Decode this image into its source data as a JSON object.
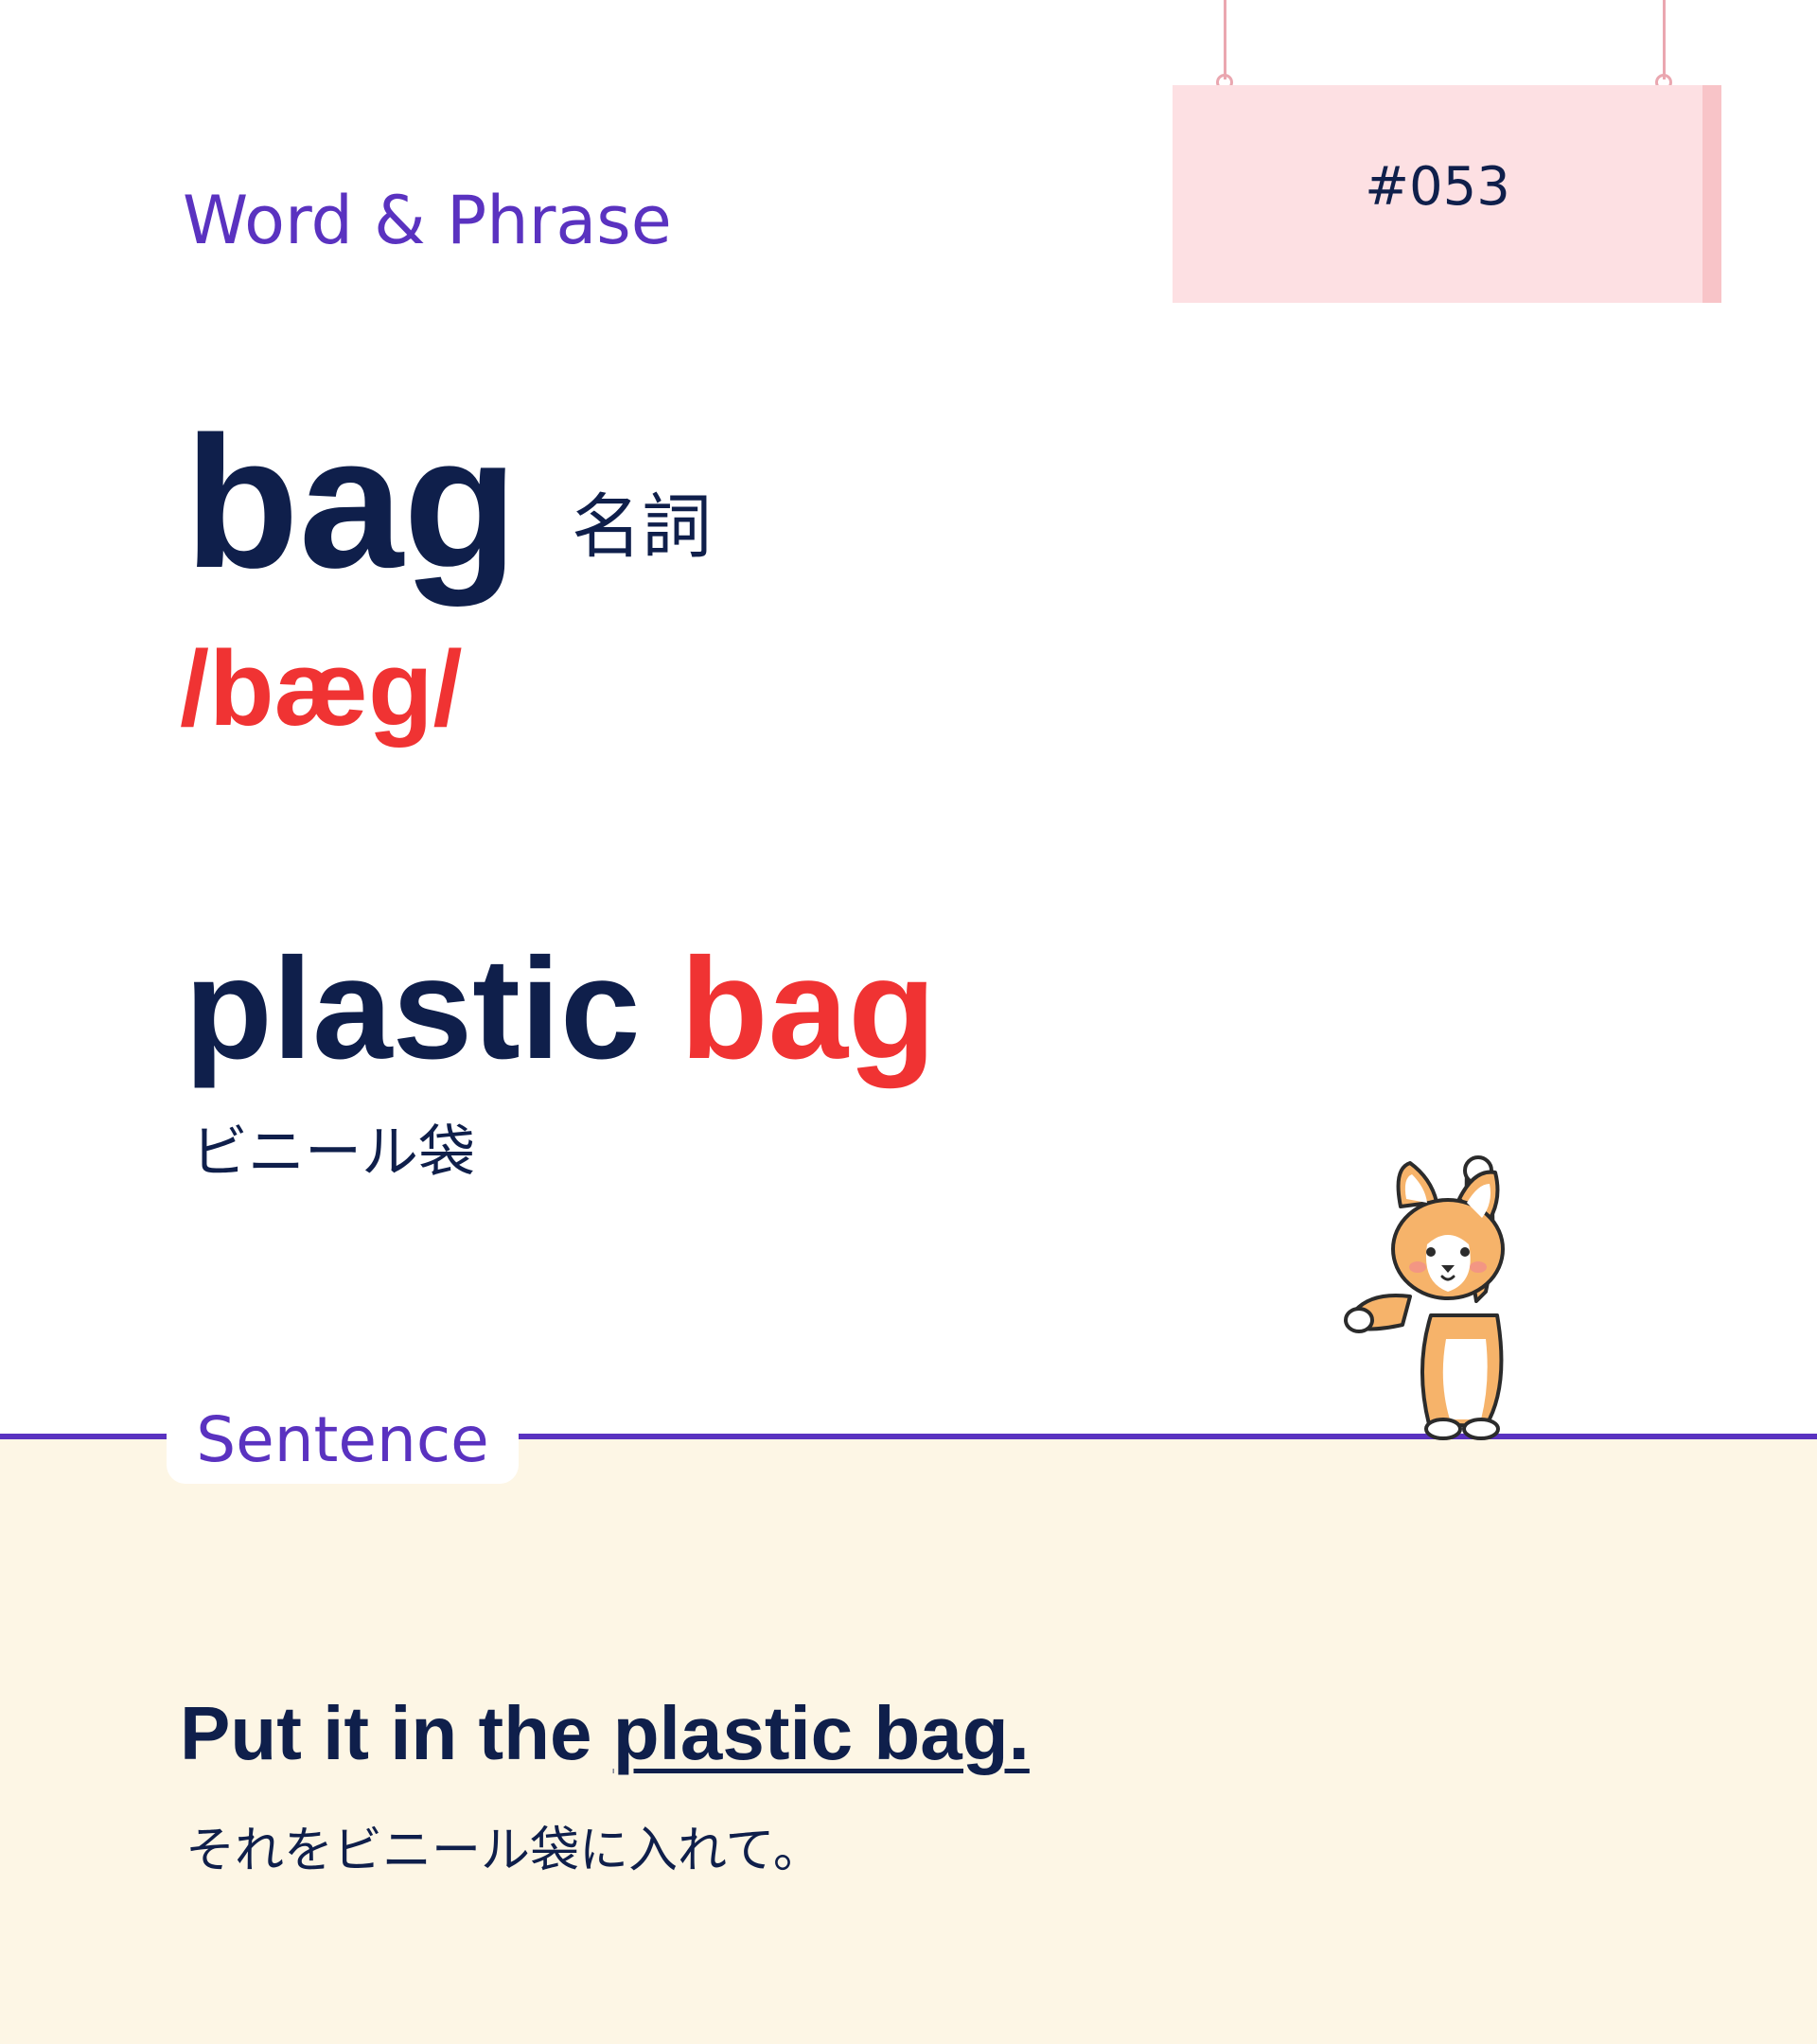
{
  "header": {
    "section_title": "Word & Phrase",
    "entry_number": "#053"
  },
  "entry": {
    "word": "bag",
    "part_of_speech": "名詞",
    "pronunciation": "/bæg/"
  },
  "phrase": {
    "prefix": "plastic ",
    "highlight": "bag",
    "translation": "ビニール袋"
  },
  "sentence": {
    "label": "Sentence",
    "prefix": "Put it in the ",
    "highlight": "plastic bag.",
    "translation": "それをビニール袋に入れて。"
  },
  "mascot": {
    "icon": "corgi-mascot-icon"
  },
  "colors": {
    "navy": "#0f1f4b",
    "accent_red": "#f03333",
    "purple": "#5a32c0",
    "sign_pink": "#fde0e3",
    "sign_edge": "#f8c4c8",
    "string_pink": "#eaa7b0",
    "band_cream": "#fdf6e5",
    "corgi_orange": "#f6b36a"
  }
}
